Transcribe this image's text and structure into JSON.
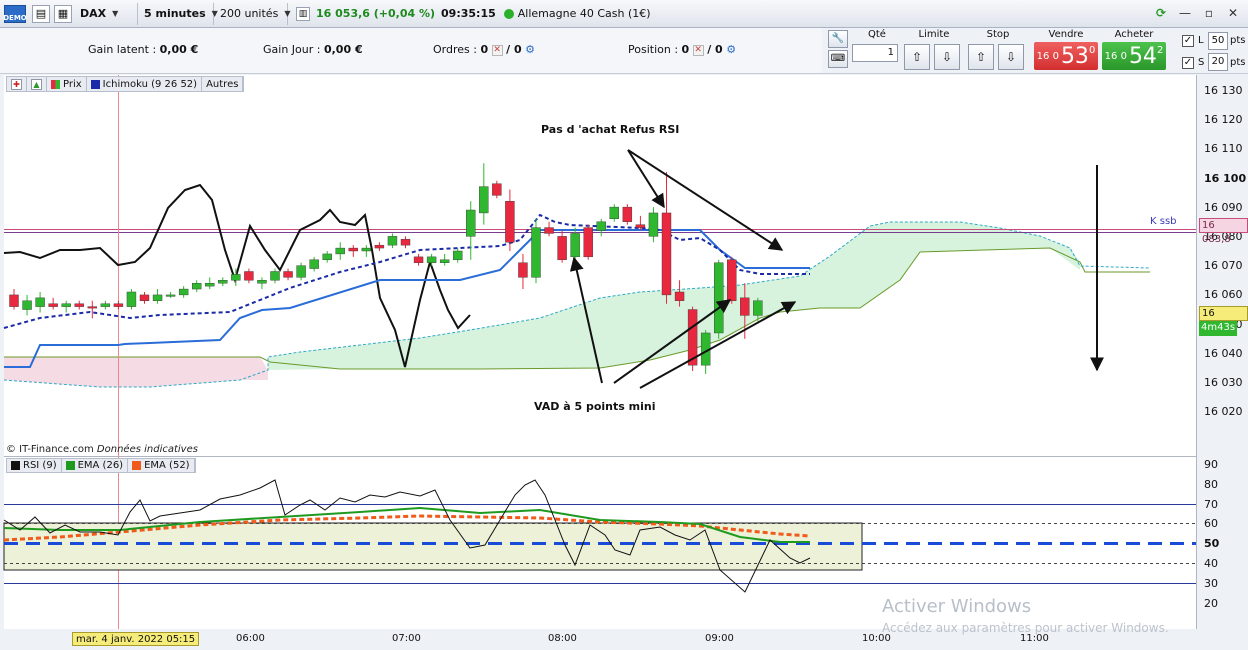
{
  "toolbar": {
    "demo_badge": "DEMO",
    "instrument": "DAX",
    "timeframe": "5 minutes",
    "units": "200 unités",
    "quote": "16 053,6 (+0,04 %)",
    "time": "09:35:15",
    "market": "Allemagne 40 Cash (1€)"
  },
  "info": {
    "gain_latent_label": "Gain latent :",
    "gain_latent_value": "0,00 €",
    "gain_jour_label": "Gain Jour :",
    "gain_jour_value": "0,00 €",
    "ordres_label": "Ordres :",
    "ordres_a": "0",
    "ordres_b": "/ 0",
    "position_label": "Position :",
    "position_a": "0",
    "position_b": "/ 0"
  },
  "order_panel": {
    "qte_label": "Qté",
    "qte_value": "1",
    "limite_label": "Limite",
    "stop_label": "Stop",
    "vendre_label": "Vendre",
    "acheter_label": "Acheter",
    "sell_prefix": "16 0",
    "sell_big": "53",
    "sell_sup": "0",
    "buy_prefix": "16 0",
    "buy_big": "54",
    "buy_sup": "2",
    "l_label": "L",
    "l_value": "50",
    "s_label": "S",
    "s_value": "20",
    "pts": "pts"
  },
  "chart_toolbar": {
    "prix": "Prix",
    "ichimoku": "Ichimoku (9 26 52)",
    "autres": "Autres"
  },
  "rsi_toolbar": {
    "rsi": "RSI (9)",
    "ema26": "EMA (26)",
    "ema52": "EMA (52)"
  },
  "annotations": {
    "top": "Pas d 'achat Refus RSI",
    "bottom": "VAD à 5 points mini"
  },
  "copyright": "© IT-Finance.com",
  "copyright_note": "Données indicatives",
  "date_flag": "mar. 4 janv. 2022 05:15",
  "x_labels": [
    "06:00",
    "07:00",
    "08:00",
    "09:00",
    "10:00",
    "11:00"
  ],
  "y_labels": [
    "16 130",
    "16 120",
    "16 110",
    "16 100",
    "16 090",
    "16 080",
    "16 070",
    "16 060",
    "16 050",
    "16 040",
    "16 030",
    "16 020"
  ],
  "rsi_labels": [
    "90",
    "80",
    "70",
    "60",
    "50",
    "40",
    "30",
    "20"
  ],
  "price_tags": {
    "ksb_label": "K ssb",
    "ksb_price": "16 083,8",
    "last_price": "16 053,6",
    "countdown": "4m43s"
  },
  "watermark": {
    "title": "Activer Windows",
    "subtitle": "Accédez aux paramètres pour activer Windows."
  },
  "chart_data": {
    "type": "candlestick",
    "y_range": [
      16015,
      16135
    ],
    "candles": [
      {
        "o": 16060,
        "h": 16062,
        "l": 16055,
        "c": 16056,
        "d": "down"
      },
      {
        "o": 16055,
        "h": 16060,
        "l": 16053,
        "c": 16058,
        "d": "up"
      },
      {
        "o": 16056,
        "h": 16061,
        "l": 16054,
        "c": 16059,
        "d": "up"
      },
      {
        "o": 16057,
        "h": 16059,
        "l": 16055,
        "c": 16056,
        "d": "down"
      },
      {
        "o": 16056,
        "h": 16058,
        "l": 16054,
        "c": 16057,
        "d": "up"
      },
      {
        "o": 16057,
        "h": 16058,
        "l": 16055,
        "c": 16056,
        "d": "down"
      },
      {
        "o": 16056,
        "h": 16058,
        "l": 16052,
        "c": 16056,
        "d": "down"
      },
      {
        "o": 16056,
        "h": 16058,
        "l": 16055,
        "c": 16057,
        "d": "up"
      },
      {
        "o": 16057,
        "h": 16058,
        "l": 16055,
        "c": 16056,
        "d": "down"
      },
      {
        "o": 16056,
        "h": 16062,
        "l": 16055,
        "c": 16061,
        "d": "up"
      },
      {
        "o": 16060,
        "h": 16061,
        "l": 16057,
        "c": 16058,
        "d": "down"
      },
      {
        "o": 16058,
        "h": 16062,
        "l": 16057,
        "c": 16060,
        "d": "up"
      },
      {
        "o": 16060,
        "h": 16061,
        "l": 16059,
        "c": 16060,
        "d": "up"
      },
      {
        "o": 16060,
        "h": 16063,
        "l": 16059,
        "c": 16062,
        "d": "up"
      },
      {
        "o": 16062,
        "h": 16065,
        "l": 16061,
        "c": 16064,
        "d": "up"
      },
      {
        "o": 16063,
        "h": 16066,
        "l": 16062,
        "c": 16064,
        "d": "up"
      },
      {
        "o": 16064,
        "h": 16066,
        "l": 16063,
        "c": 16065,
        "d": "up"
      },
      {
        "o": 16065,
        "h": 16069,
        "l": 16063,
        "c": 16067,
        "d": "up"
      },
      {
        "o": 16068,
        "h": 16069,
        "l": 16064,
        "c": 16065,
        "d": "down"
      },
      {
        "o": 16064,
        "h": 16066,
        "l": 16062,
        "c": 16065,
        "d": "up"
      },
      {
        "o": 16065,
        "h": 16069,
        "l": 16064,
        "c": 16068,
        "d": "up"
      },
      {
        "o": 16068,
        "h": 16069,
        "l": 16065,
        "c": 16066,
        "d": "down"
      },
      {
        "o": 16066,
        "h": 16071,
        "l": 16065,
        "c": 16070,
        "d": "up"
      },
      {
        "o": 16069,
        "h": 16073,
        "l": 16068,
        "c": 16072,
        "d": "up"
      },
      {
        "o": 16072,
        "h": 16075,
        "l": 16071,
        "c": 16074,
        "d": "up"
      },
      {
        "o": 16074,
        "h": 16078,
        "l": 16072,
        "c": 16076,
        "d": "up"
      },
      {
        "o": 16076,
        "h": 16077,
        "l": 16073,
        "c": 16075,
        "d": "down"
      },
      {
        "o": 16075,
        "h": 16077,
        "l": 16073,
        "c": 16076,
        "d": "up"
      },
      {
        "o": 16077,
        "h": 16078,
        "l": 16075,
        "c": 16076,
        "d": "down"
      },
      {
        "o": 16077,
        "h": 16081,
        "l": 16076,
        "c": 16080,
        "d": "up"
      },
      {
        "o": 16079,
        "h": 16080,
        "l": 16076,
        "c": 16077,
        "d": "down"
      },
      {
        "o": 16073,
        "h": 16074,
        "l": 16070,
        "c": 16071,
        "d": "down"
      },
      {
        "o": 16071,
        "h": 16074,
        "l": 16070,
        "c": 16073,
        "d": "up"
      },
      {
        "o": 16071,
        "h": 16074,
        "l": 16070,
        "c": 16072,
        "d": "up"
      },
      {
        "o": 16072,
        "h": 16076,
        "l": 16071,
        "c": 16075,
        "d": "up"
      },
      {
        "o": 16080,
        "h": 16092,
        "l": 16072,
        "c": 16089,
        "d": "up"
      },
      {
        "o": 16088,
        "h": 16105,
        "l": 16084,
        "c": 16097,
        "d": "up"
      },
      {
        "o": 16098,
        "h": 16099,
        "l": 16093,
        "c": 16094,
        "d": "down"
      },
      {
        "o": 16092,
        "h": 16096,
        "l": 16075,
        "c": 16078,
        "d": "down"
      },
      {
        "o": 16071,
        "h": 16074,
        "l": 16062,
        "c": 16066,
        "d": "down"
      },
      {
        "o": 16066,
        "h": 16086,
        "l": 16064,
        "c": 16083,
        "d": "up"
      },
      {
        "o": 16083,
        "h": 16085,
        "l": 16080,
        "c": 16081,
        "d": "down"
      },
      {
        "o": 16080,
        "h": 16082,
        "l": 16071,
        "c": 16072,
        "d": "down"
      },
      {
        "o": 16073,
        "h": 16083,
        "l": 16072,
        "c": 16081,
        "d": "up"
      },
      {
        "o": 16083,
        "h": 16084,
        "l": 16072,
        "c": 16073,
        "d": "down"
      },
      {
        "o": 16082,
        "h": 16086,
        "l": 16080,
        "c": 16085,
        "d": "up"
      },
      {
        "o": 16086,
        "h": 16091,
        "l": 16085,
        "c": 16090,
        "d": "up"
      },
      {
        "o": 16090,
        "h": 16091,
        "l": 16084,
        "c": 16085,
        "d": "down"
      },
      {
        "o": 16084,
        "h": 16087,
        "l": 16082,
        "c": 16083,
        "d": "down"
      },
      {
        "o": 16080,
        "h": 16090,
        "l": 16078,
        "c": 16088,
        "d": "up"
      },
      {
        "o": 16088,
        "h": 16102,
        "l": 16057,
        "c": 16060,
        "d": "down"
      },
      {
        "o": 16061,
        "h": 16065,
        "l": 16056,
        "c": 16058,
        "d": "down"
      },
      {
        "o": 16055,
        "h": 16056,
        "l": 16034,
        "c": 16036,
        "d": "down"
      },
      {
        "o": 16036,
        "h": 16048,
        "l": 16033,
        "c": 16047,
        "d": "up"
      },
      {
        "o": 16047,
        "h": 16072,
        "l": 16045,
        "c": 16071,
        "d": "up"
      },
      {
        "o": 16072,
        "h": 16073,
        "l": 16057,
        "c": 16058,
        "d": "down"
      },
      {
        "o": 16059,
        "h": 16064,
        "l": 16045,
        "c": 16053,
        "d": "down"
      },
      {
        "o": 16053,
        "h": 16059,
        "l": 16051,
        "c": 16058,
        "d": "up"
      }
    ]
  },
  "colors": {
    "up": "#2fb82f",
    "down": "#e8283f",
    "chart_bg": "#ffffff",
    "rsi_band": "#ecf1d8",
    "cloud_green": "#d7f3de",
    "cloud_red": "#f5dbe4"
  }
}
